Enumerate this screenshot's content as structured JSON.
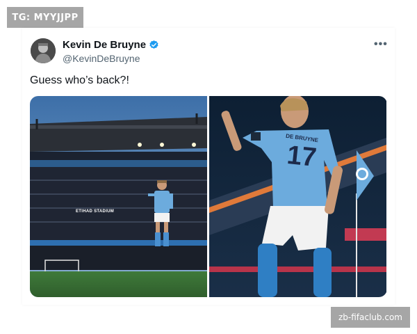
{
  "corner_tag": "TG: MYYJJPP",
  "tweet": {
    "author_name": "Kevin De Bruyne",
    "handle": "@KevinDeBruyne",
    "text": "Guess who’s back?!",
    "more_icon": "more-horizontal-icon",
    "verified_icon": "verified-badge-icon"
  },
  "images": {
    "left_alt": "",
    "right_alt": ""
  },
  "scene_text": {
    "stadium_banner": "ETIHAD STADIUM",
    "shirt_name": "DE BRUYNE",
    "shirt_number": "17"
  },
  "watermark": "zb-fifaclub.com",
  "colors": {
    "verified_blue": "#1d9bf0",
    "city_blue": "#6cabdd",
    "text_primary": "#0f1419",
    "text_secondary": "#536471"
  }
}
